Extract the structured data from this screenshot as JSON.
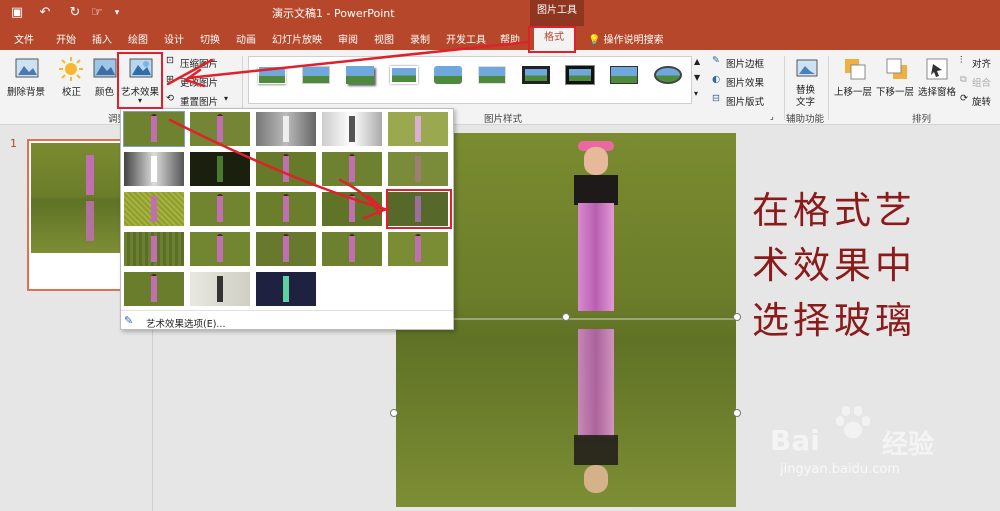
{
  "window": {
    "title": "演示文稿1 - PowerPoint",
    "context_group": "图片工具"
  },
  "tabs": [
    "文件",
    "开始",
    "插入",
    "绘图",
    "设计",
    "切换",
    "动画",
    "幻灯片放映",
    "审阅",
    "视图",
    "录制",
    "开发工具",
    "帮助"
  ],
  "active_tab": "格式",
  "tell_me": "操作说明搜索",
  "ribbon": {
    "remove_bg": "删除背景",
    "corrections": "校正",
    "color": "颜色",
    "artistic_effects": "艺术效果",
    "compress": "压缩图片",
    "change_picture": "更改图片",
    "reset_picture": "重置图片",
    "adjust_group": "调整",
    "picture_styles_group": "图片样式",
    "picture_border": "图片边框",
    "picture_effects": "图片效果",
    "picture_layout": "图片版式",
    "alt_text_line1": "替换",
    "alt_text_line2": "文字",
    "accessibility_group": "辅助功能",
    "bring_forward": "上移一层",
    "send_backward": "下移一层",
    "selection_pane": "选择窗格",
    "align": "对齐",
    "group": "组合",
    "rotate": "旋转",
    "arrange_group": "排列"
  },
  "dropdown": {
    "options_label": "艺术效果选项(E)..."
  },
  "thumbnail": {
    "slide_number": "1"
  },
  "annotation": {
    "line1": "在格式艺",
    "line2": "术效果中",
    "line3": "选择玻璃"
  },
  "watermark": {
    "brand": "Bai",
    "brand2": "经验",
    "url": "jingyan.baidu.com"
  },
  "colors": {
    "accent": "#b7472a",
    "annotation_red": "#e0202a",
    "annotation_text": "#8b1a1a"
  }
}
